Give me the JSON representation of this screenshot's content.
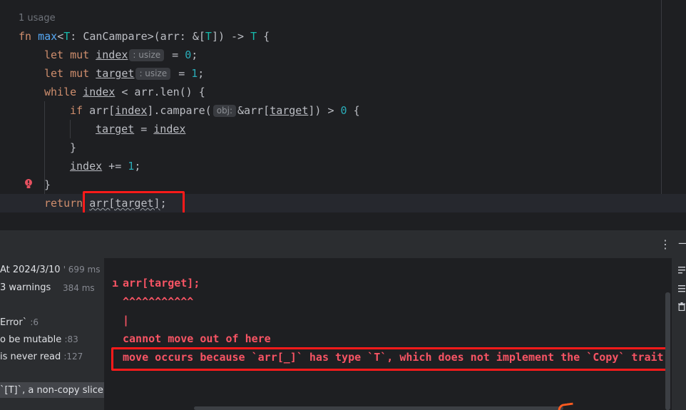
{
  "editor": {
    "usage_hint": "1 usage",
    "sig": {
      "fn_kw": "fn",
      "fn_name": "max",
      "generic_open": "<",
      "generic_T": "T",
      "colon": ": ",
      "trait": "CanCampare",
      "generic_close": ">",
      "params": "(arr: &[",
      "param_T": "T",
      "params_end": "]) -> ",
      "ret_T": "T",
      "brace": " {"
    },
    "line_index": {
      "kw": "let mut ",
      "var": "index",
      "hint": ": usize",
      "eq": " = ",
      "num": "0",
      "end": ";"
    },
    "line_target": {
      "kw": "let mut ",
      "var": "target",
      "hint": ": usize",
      "eq": " = ",
      "num": "1",
      "end": ";"
    },
    "line_while": {
      "kw": "while ",
      "var": "index",
      "rest": " < arr.len() {"
    },
    "line_if": {
      "kw": "if ",
      "a": "arr[",
      "v1": "index",
      "b": "].campare(",
      "hint": "obj:",
      "c": "&arr[",
      "v2": "target",
      "d": "]) > ",
      "num": "0",
      "e": " {"
    },
    "line_assign": {
      "v1": "target",
      "eq": " = ",
      "v2": "index"
    },
    "line_close_if": "}",
    "line_inc": {
      "var": "index",
      "op": " += ",
      "num": "1",
      "end": ";"
    },
    "line_close_while": "}",
    "line_return": {
      "kw": "return ",
      "expr": "arr[target]",
      "end": ";"
    }
  },
  "toolwindow": {
    "kebab": "⋮",
    "minus": "—"
  },
  "tree": {
    "rows": [
      {
        "label": "At 2024/3/10 ",
        "meta": "' 699 ms"
      },
      {
        "label": "3 warnings",
        "meta": "384 ms"
      },
      {
        "label": "Error` ",
        "meta": ":6"
      },
      {
        "label": "o be mutable ",
        "meta": ":83"
      },
      {
        "label": " is never read ",
        "meta": ":127"
      },
      {
        "label": " `[T]`, a non-copy slice",
        "meta": ""
      }
    ]
  },
  "console": {
    "lines": [
      "arr[target];",
      "^^^^^^^^^^^",
      "|",
      "cannot move out of here",
      "move occurs because `arr[_]` has type `T`, which does not implement the `Copy` trait"
    ],
    "gutter_mark": "ı"
  },
  "colors": {
    "keyword": "#cf8e6d",
    "function": "#56a8f5",
    "type": "#16baac",
    "number": "#2aacb8",
    "error_text": "#f75464",
    "highlight_box": "#ff1a1a"
  }
}
